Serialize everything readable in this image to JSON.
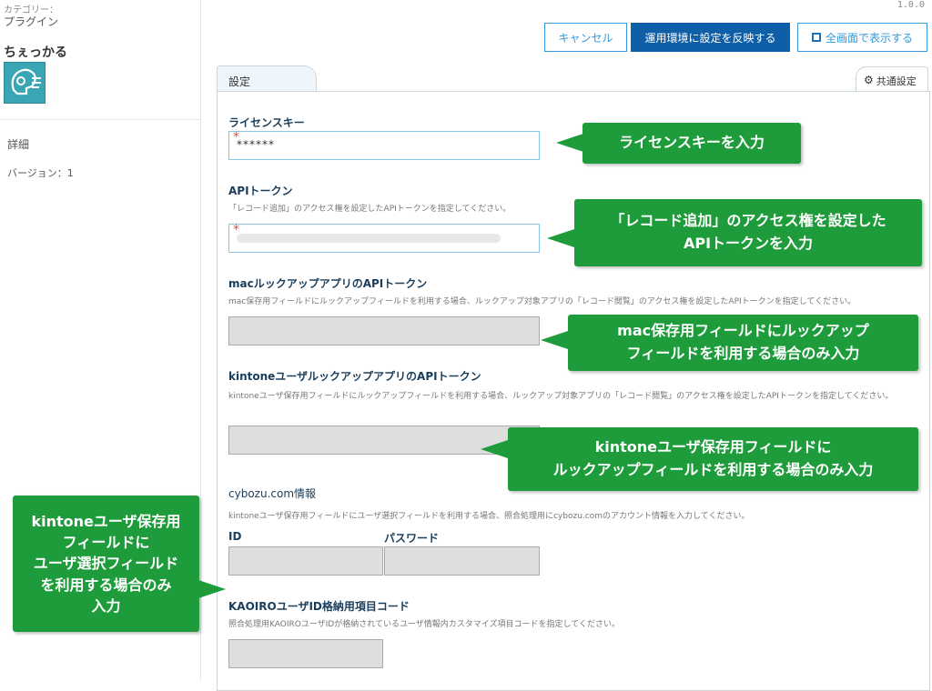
{
  "sidebar": {
    "category_label": "カテゴリー：",
    "category_value": "プラグイン",
    "plugin_name": "ちぇっかる",
    "detail": "詳細",
    "version": "バージョン：1"
  },
  "version_number": "1.0.0",
  "buttons": {
    "cancel": "キャンセル",
    "apply": "運用環境に設定を反映する",
    "fullscreen": "全画面で表示する"
  },
  "tabs": {
    "settings": "設定",
    "common": "共通設定"
  },
  "form": {
    "license": {
      "label": "ライセンスキー",
      "value": "******"
    },
    "api_token": {
      "label": "APIトークン",
      "desc": "「レコード追加」のアクセス権を設定したAPIトークンを指定してください。"
    },
    "mac_lookup": {
      "label": "macルックアップアプリのAPIトークン",
      "desc": "mac保存用フィールドにルックアップフィールドを利用する場合、ルックアップ対象アプリの「レコード閲覧」のアクセス権を設定したAPIトークンを指定してください。"
    },
    "kintone_lookup": {
      "label": "kintoneユーザルックアップアプリのAPIトークン",
      "desc": "kintoneユーザ保存用フィールドにルックアップフィールドを利用する場合、ルックアップ対象アプリの「レコード閲覧」のアクセス権を設定したAPIトークンを指定してください。"
    },
    "cybozu": {
      "label": "cybozu.com情報",
      "desc": "kintoneユーザ保存用フィールドにユーザ選択フィールドを利用する場合、照合処理用にcybozu.comのアカウント情報を入力してください。",
      "id_label": "ID",
      "password_label": "パスワード"
    },
    "kaoiro": {
      "label": "KAOIROユーザID格納用項目コード",
      "desc": "照合処理用KAOIROユーザIDが格納されているユーザ情報内カスタマイズ項目コードを指定してください。"
    }
  },
  "callouts": {
    "license": "ライセンスキーを入力",
    "api_line1": "「レコード追加」のアクセス権を設定した",
    "api_line2": "APIトークンを入力",
    "mac_line1": "mac保存用フィールドにルックアップ",
    "mac_line2": "フィールドを利用する場合のみ入力",
    "kintone_line1": "kintoneユーザ保存用フィールドに",
    "kintone_line2": "ルックアップフィールドを利用する場合のみ入力",
    "cybozu_line1": "kintoneユーザ保存用",
    "cybozu_line2": "フィールドに",
    "cybozu_line3": "ユーザ選択フィールド",
    "cybozu_line4": "を利用する場合のみ",
    "cybozu_line5": "入力"
  },
  "colors": {
    "callout": "#1e9c3b",
    "primary": "#0f5ea8",
    "accent": "#3498db"
  }
}
